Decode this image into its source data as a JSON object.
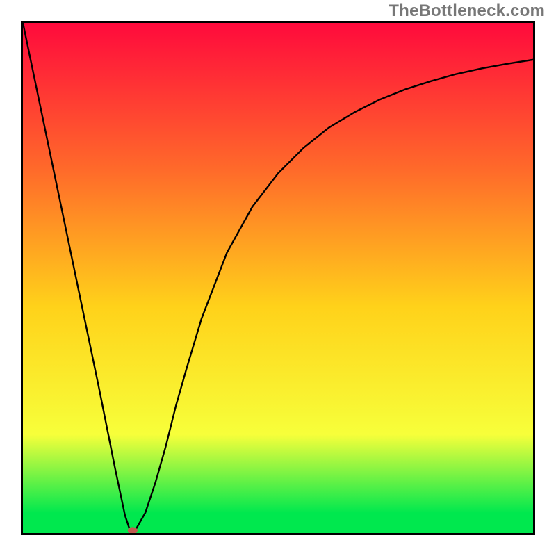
{
  "watermark": "TheBottleneck.com",
  "colors": {
    "frame_border": "#000000",
    "gradient_top": "#ff0a3c",
    "gradient_mid1": "#ff6a2a",
    "gradient_mid2": "#ffd21a",
    "gradient_mid3": "#f7ff3a",
    "gradient_bottom": "#00e84e",
    "curve": "#000000",
    "marker": "#c05a50"
  },
  "chart_data": {
    "type": "line",
    "title": "",
    "xlabel": "",
    "ylabel": "",
    "xlim": [
      0,
      100
    ],
    "ylim": [
      0,
      100
    ],
    "grid": false,
    "legend": false,
    "series": [
      {
        "name": "bottleneck-curve",
        "x": [
          0,
          5,
          10,
          15,
          18,
          20,
          21,
          22,
          24,
          26,
          28,
          30,
          32,
          35,
          40,
          45,
          50,
          55,
          60,
          65,
          70,
          75,
          80,
          85,
          90,
          95,
          100
        ],
        "y": [
          100,
          76,
          52,
          28,
          13,
          3.5,
          0.5,
          0.5,
          4,
          10,
          17,
          25,
          32,
          42,
          55,
          64,
          70.5,
          75.5,
          79.5,
          82.5,
          85,
          87,
          88.6,
          90,
          91.1,
          92,
          92.8
        ]
      }
    ],
    "markers": [
      {
        "name": "min-point",
        "x": 21.5,
        "y": 0.5
      }
    ]
  }
}
